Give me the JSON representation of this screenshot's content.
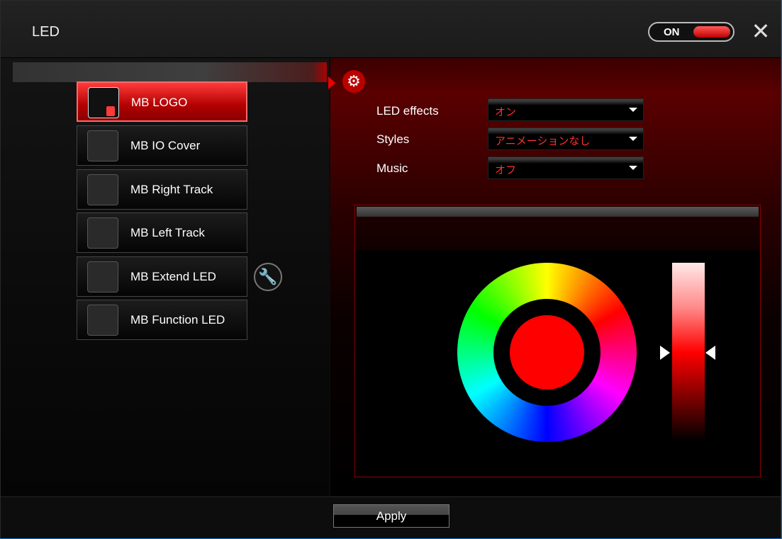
{
  "window": {
    "title": "LED",
    "power": {
      "label": "ON",
      "state": true
    }
  },
  "device_list": {
    "items": [
      {
        "label": "MB LOGO",
        "active": true
      },
      {
        "label": "MB IO Cover",
        "active": false
      },
      {
        "label": "MB Right Track",
        "active": false
      },
      {
        "label": "MB Left Track",
        "active": false
      },
      {
        "label": "MB Extend LED",
        "active": false
      },
      {
        "label": "MB Function LED",
        "active": false
      }
    ]
  },
  "settings": {
    "led_effects_label": "LED effects",
    "led_effects_value": "オン",
    "styles_label": "Styles",
    "styles_value": "アニメーションなし",
    "music_label": "Music",
    "music_value": "オフ"
  },
  "color": {
    "selected_hex": "#ff0000"
  },
  "footer": {
    "apply_label": "Apply"
  },
  "colors": {
    "accent": "#ff0000",
    "background": "#0b0b0b",
    "dropdown_text": "#ff3030"
  },
  "icons": {
    "settings": "gear-icon",
    "tools": "wrench-icon",
    "close": "close-icon"
  }
}
